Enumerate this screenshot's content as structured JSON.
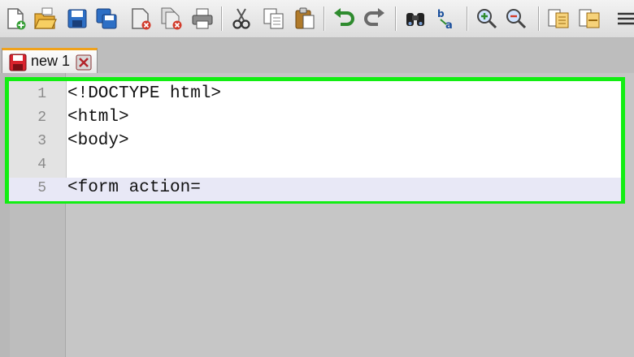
{
  "toolbar": {
    "buttons": [
      {
        "name": "new-file",
        "icon": "new-file-icon"
      },
      {
        "name": "open-file",
        "icon": "folder-open-icon"
      },
      {
        "name": "save",
        "icon": "save-icon"
      },
      {
        "name": "save-all",
        "icon": "save-all-icon"
      },
      {
        "name": "close",
        "icon": "close-file-icon"
      },
      {
        "name": "close-all",
        "icon": "close-all-icon"
      },
      {
        "name": "print",
        "icon": "printer-icon"
      },
      {
        "name": "cut",
        "icon": "scissors-icon"
      },
      {
        "name": "copy",
        "icon": "copy-icon"
      },
      {
        "name": "paste",
        "icon": "clipboard-icon"
      },
      {
        "name": "undo",
        "icon": "undo-icon"
      },
      {
        "name": "redo",
        "icon": "redo-icon"
      },
      {
        "name": "find",
        "icon": "binoculars-icon"
      },
      {
        "name": "replace",
        "icon": "replace-icon"
      },
      {
        "name": "zoom-in",
        "icon": "zoom-in-icon"
      },
      {
        "name": "zoom-out",
        "icon": "zoom-out-icon"
      },
      {
        "name": "sync-vertical",
        "icon": "sync-vertical-icon"
      },
      {
        "name": "sync-horizontal",
        "icon": "sync-horizontal-icon"
      },
      {
        "name": "word-wrap",
        "icon": "word-wrap-icon"
      }
    ]
  },
  "tab": {
    "label": "new 1",
    "save_icon": "unsaved-disk-icon",
    "close_icon": "close-icon"
  },
  "editor": {
    "lines": [
      {
        "number": "1",
        "text": "<!DOCTYPE html>"
      },
      {
        "number": "2",
        "text": "<html>"
      },
      {
        "number": "3",
        "text": "<body>"
      },
      {
        "number": "4",
        "text": ""
      },
      {
        "number": "5",
        "text": "<form action="
      }
    ],
    "current_line": 5
  },
  "colors": {
    "highlight_border": "#12ee12",
    "current_line_bg": "#e8e8f6",
    "tab_accent": "#f0a21b"
  }
}
